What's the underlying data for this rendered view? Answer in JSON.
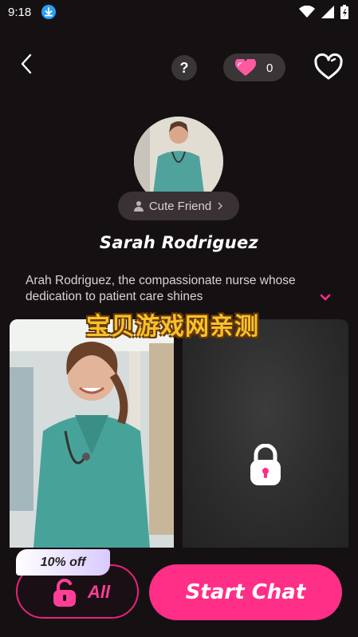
{
  "status_bar": {
    "time": "9:18"
  },
  "header": {
    "coin_count": "0"
  },
  "profile": {
    "badge_label": "Cute Friend",
    "name": "Sarah Rodriguez",
    "description": "Arah Rodriguez, the compassionate nurse whose dedication to patient care shines"
  },
  "watermark": "宝贝游戏网亲测",
  "actions": {
    "discount_label": "10% off",
    "unlock_all_label": "All",
    "start_chat_label": "Start Chat"
  },
  "colors": {
    "accent": "#ff2e86",
    "background": "#151113",
    "pill": "#3a3537"
  },
  "icons": [
    "download-icon",
    "wifi-icon",
    "signal-icon",
    "battery-icon",
    "back-icon",
    "help-icon",
    "heart-coin-icon",
    "favorite-icon",
    "person-icon",
    "chevron-right-icon",
    "chevron-down-icon",
    "lock-icon"
  ]
}
